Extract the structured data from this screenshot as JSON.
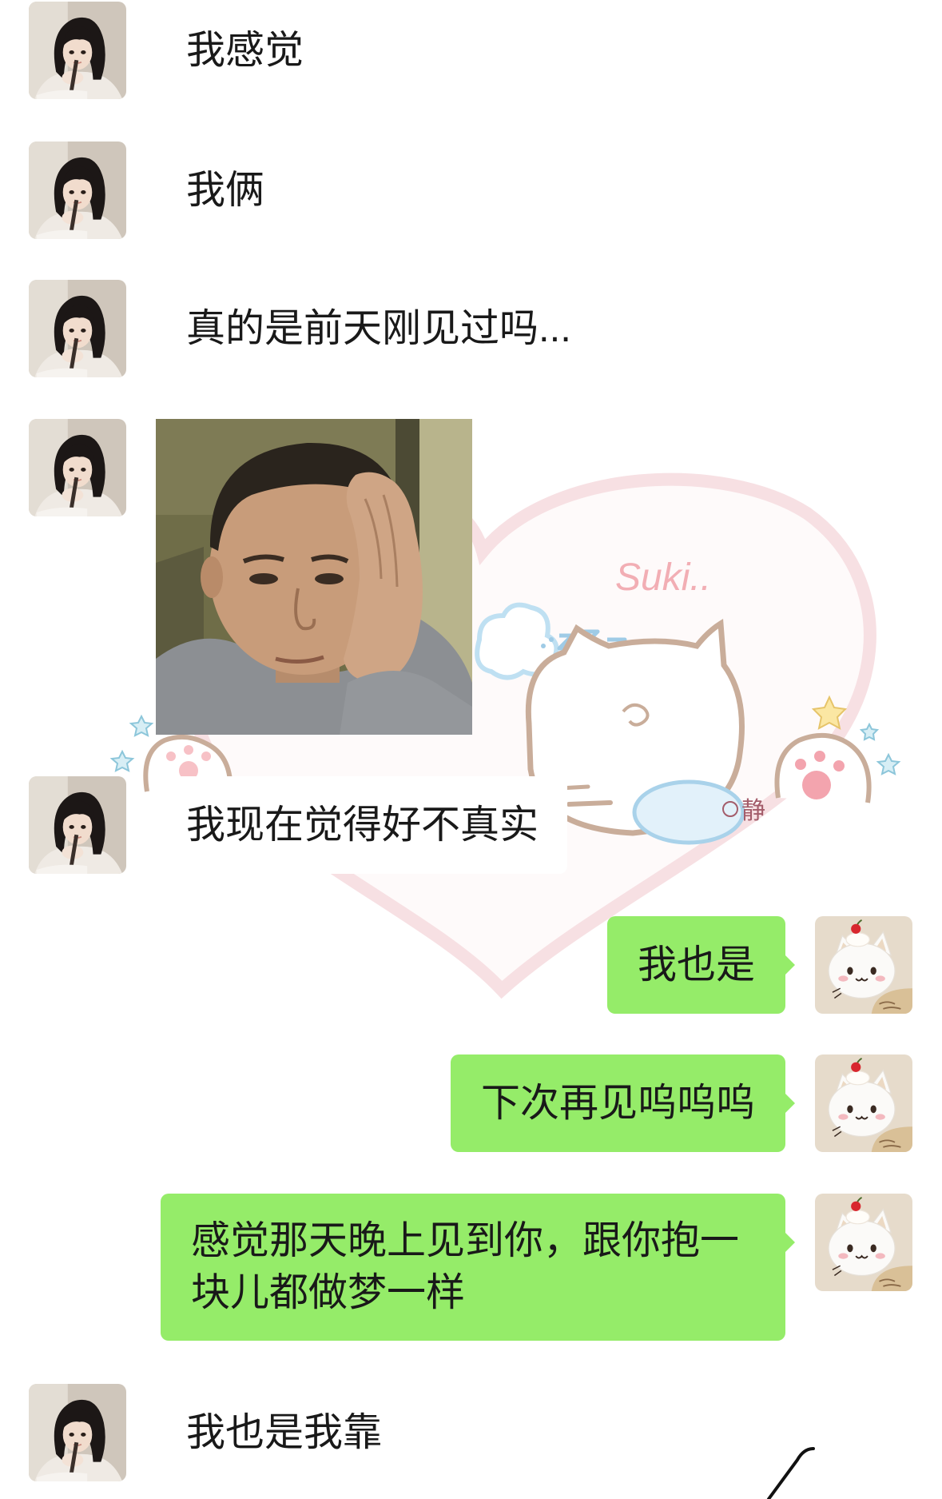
{
  "chat": {
    "messages": [
      {
        "side": "left",
        "type": "text",
        "text": "我感觉"
      },
      {
        "side": "left",
        "type": "text",
        "text": "我俩"
      },
      {
        "side": "left",
        "type": "text",
        "text": "真的是前天刚见过吗..."
      },
      {
        "side": "left",
        "type": "image"
      },
      {
        "side": "left",
        "type": "text",
        "text": "我现在觉得好不真实"
      },
      {
        "side": "right",
        "type": "text",
        "text": "我也是"
      },
      {
        "side": "right",
        "type": "text",
        "text": "下次再见呜呜呜"
      },
      {
        "side": "right",
        "type": "text",
        "text": "感觉那天晚上见到你，跟你抱一块儿都做梦一样"
      },
      {
        "side": "left",
        "type": "text",
        "text": "我也是我靠"
      }
    ]
  },
  "avatars": {
    "left_icon": "girl-avatar-icon",
    "right_icon": "cat-avatar-icon"
  },
  "background_art": {
    "lettering": [
      "Suki..",
      "静"
    ]
  },
  "colors": {
    "right_bubble": "#95ec69",
    "left_bubble": "#ffffff",
    "text": "#191919",
    "page_background": "#ffffff"
  }
}
